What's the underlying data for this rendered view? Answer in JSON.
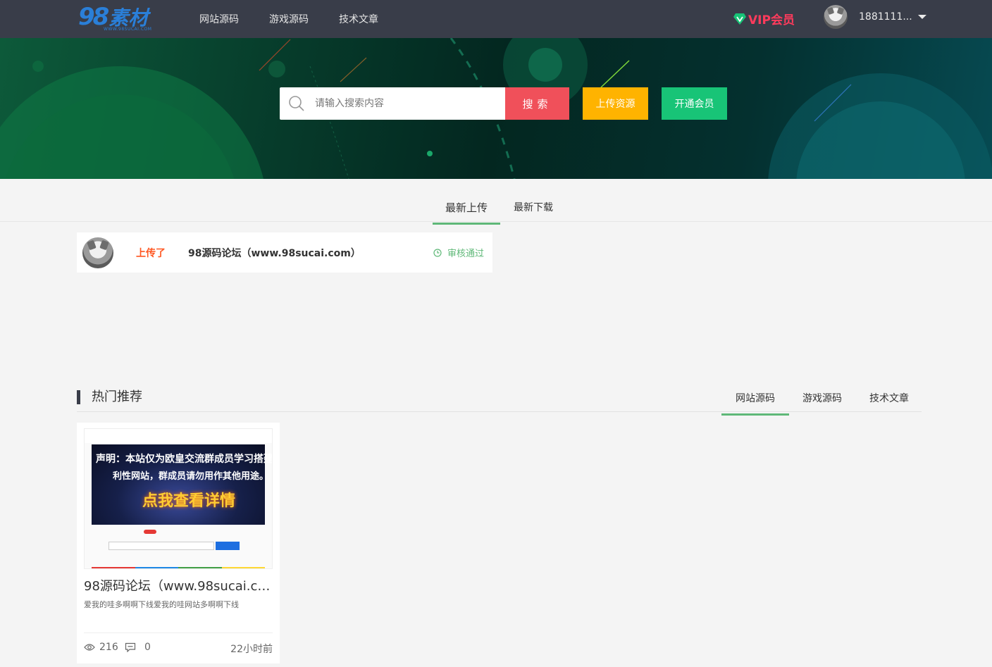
{
  "header": {
    "logo_num": "98",
    "logo_text": "素材",
    "logo_sub": "WWW.98SUCAI.COM",
    "nav": [
      "网站源码",
      "游戏源码",
      "技术文章"
    ],
    "vip_label": "VIP会员",
    "username": "1881111...",
    "colors": {
      "bg": "#393d49",
      "vip": "#ff3b5c",
      "logo": "#2a7fd8"
    }
  },
  "hero": {
    "search_placeholder": "请输入搜索内容",
    "search_button": "搜索",
    "upload_button": "上传资源",
    "vip_button": "开通会员",
    "colors": {
      "search": "#f0505a",
      "upload": "#ffb300",
      "vip": "#18c477"
    }
  },
  "tabs": {
    "latest_upload": "最新上传",
    "latest_download": "最新下载"
  },
  "upload_feed": [
    {
      "action": "上传了",
      "title": "98源码论坛（www.98sucai.com）",
      "status": "审核通过"
    }
  ],
  "hot": {
    "title": "热门推荐",
    "tabs": [
      "网站源码",
      "游戏源码",
      "技术文章"
    ],
    "active_tab": "网站源码",
    "cards": [
      {
        "title": "98源码论坛（www.98sucai.co...",
        "desc": "爱我的哇多啊啊下线爱我的哇网站多啊啊下线",
        "views": "216",
        "comments": "0",
        "time": "22小时前",
        "thumb": {
          "line1": "声明：本站仅为欧皇交流群成员学习搭建，非盈",
          "line2": "利性网站，群成员请勿用作其他用途。",
          "line3": "点我查看详情"
        }
      }
    ]
  }
}
